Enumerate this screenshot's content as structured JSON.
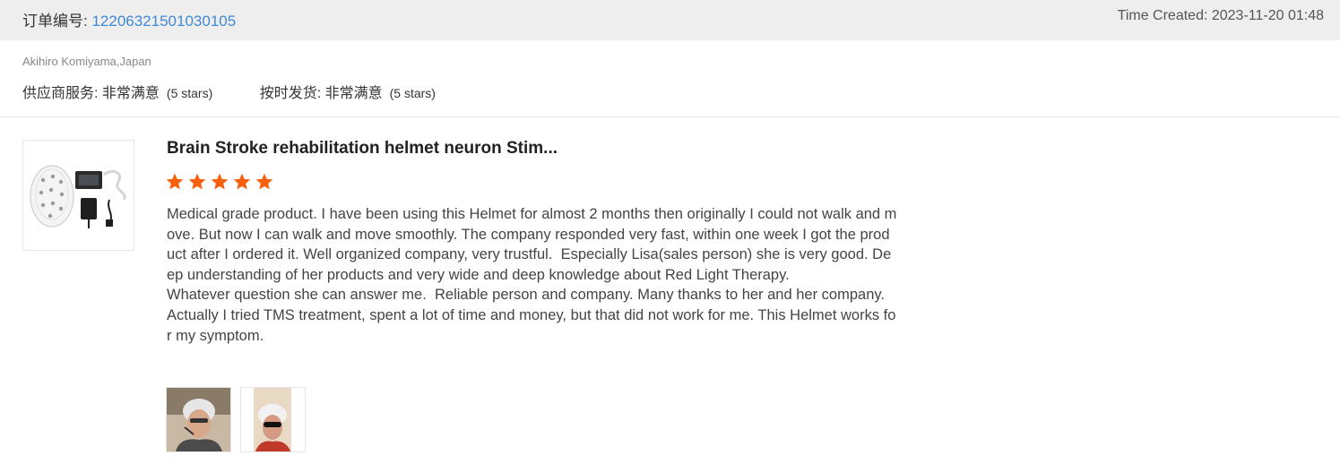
{
  "order": {
    "id_label": "订单编号: ",
    "id_value": "12206321501030105",
    "time_created": "Time Created: 2023-11-20 01:48"
  },
  "review": {
    "reviewer": "Akihiro Komiyama,Japan",
    "supplier_service": {
      "label": "供应商服务: 非常满意",
      "stars_note": "(5 stars)"
    },
    "on_time_shipment": {
      "label": "按时发货: 非常满意",
      "stars_note": "(5 stars)"
    },
    "product_title": "Brain Stroke rehabilitation helmet neuron Stim...",
    "rating": 5,
    "rating_max": 5,
    "star_color": "#f7600e",
    "text": "Medical grade product. I have been using this Helmet for almost 2 months then originally I could not walk and move. But now I can walk and move smoothly. The company responded very fast, within one week I got the product after I ordered it. Well organized company, very trustful.  Especially Lisa(sales person) she is very good. Deep understanding of her products and very wide and deep knowledge about Red Light Therapy.\nWhatever question she can answer me.  Reliable person and company. Many thanks to her and her company.\nActually I tried TMS treatment, spent a lot of time and money, but that did not work for me. This Helmet works for my symptom."
  },
  "colors": {
    "header_bg": "#eeeeee",
    "link": "#3f8ad6"
  }
}
